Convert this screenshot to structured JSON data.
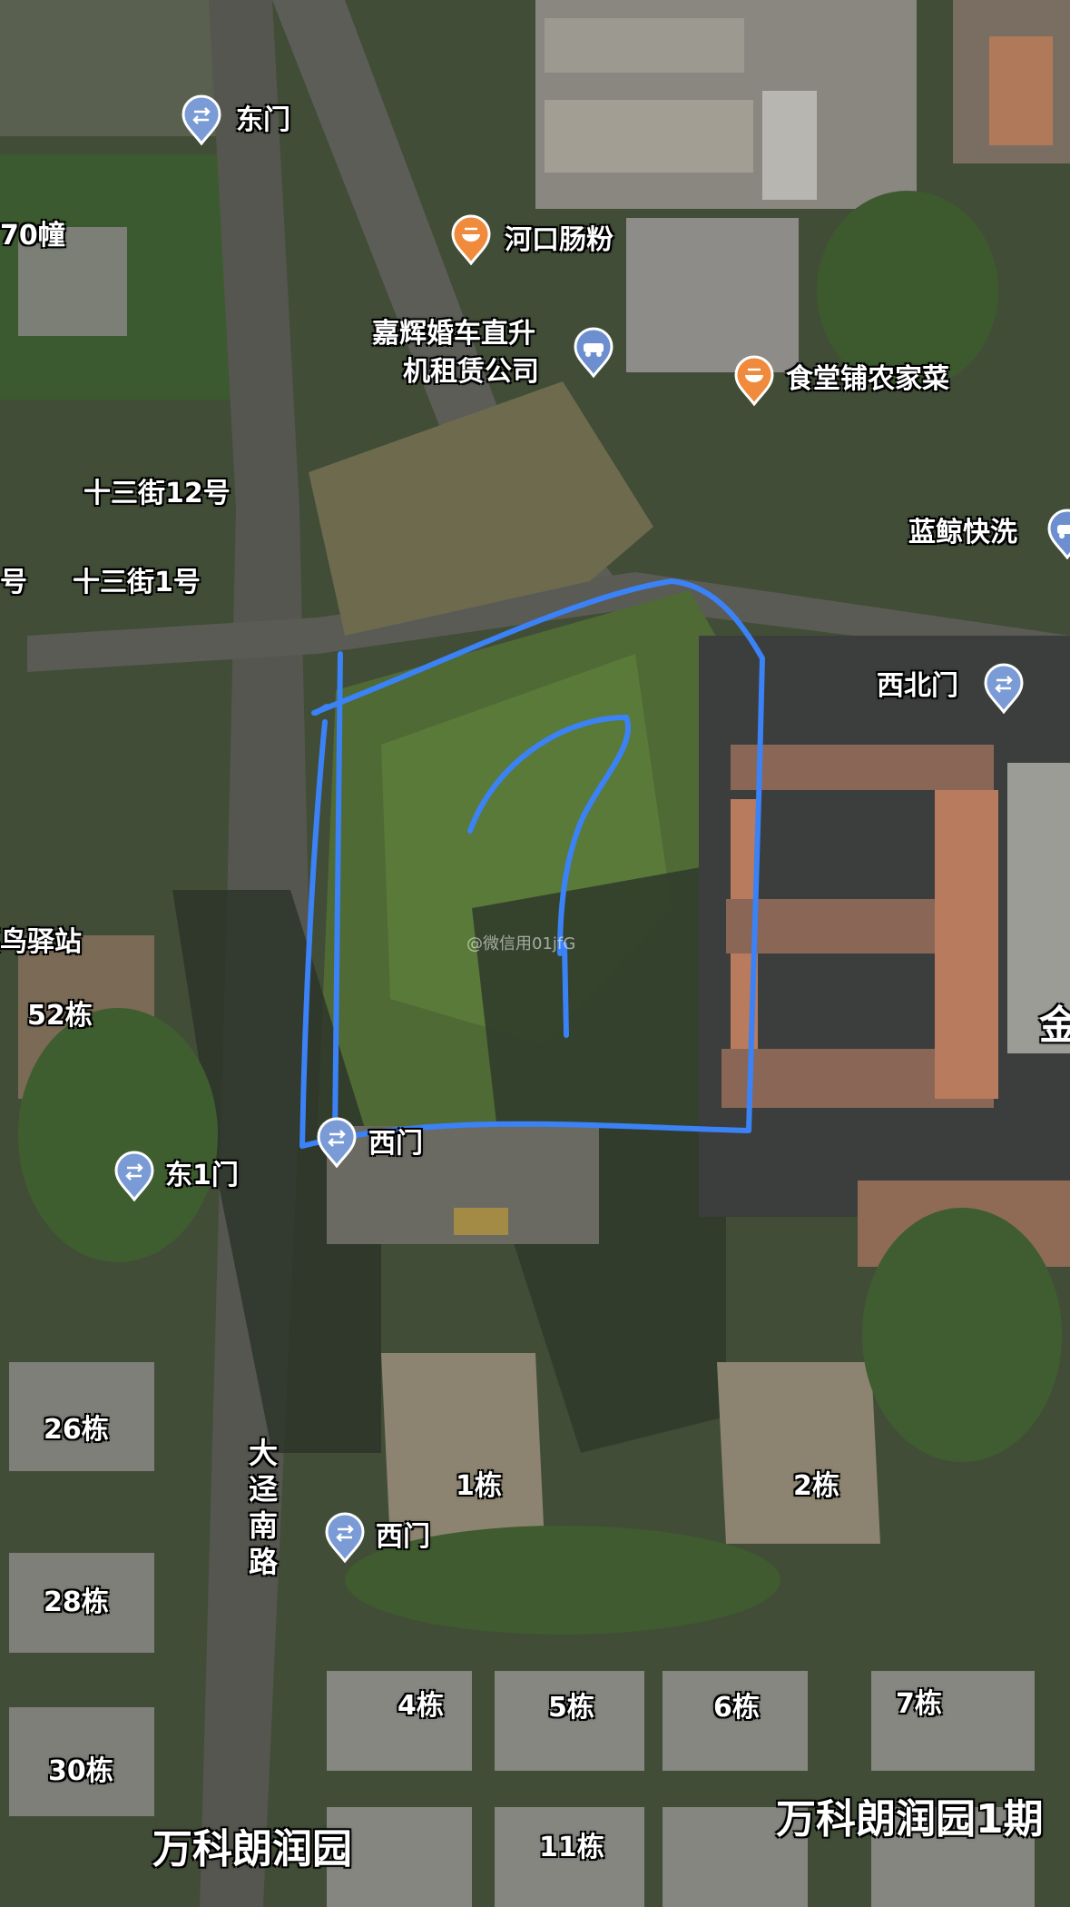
{
  "map": {
    "labels": {
      "dongmen_top": "东门",
      "lot70": "70幢",
      "hekou": "河口肠粉",
      "jiahui": "嘉辉婚车直升",
      "jiahui2": "机租赁公司",
      "shitang": "食堂铺农家菜",
      "jie12": "十三街12号",
      "hao_left": "号",
      "jie1": "十三街1号",
      "lanjing": "蓝鲸快洗",
      "xibeimen": "西北门",
      "cainiao": "菜鸟驿站",
      "b52": "52栋",
      "jin": "金",
      "ximen_mid": "西门",
      "dong1men": "东1门",
      "b26": "26栋",
      "b1": "1栋",
      "b2": "2栋",
      "road": "大迳南路",
      "ximen_low": "西门",
      "b28": "28栋",
      "b4": "4栋",
      "b5": "5栋",
      "b6": "6栋",
      "b7": "7栋",
      "b30": "30栋",
      "vanke_left": "万科朗润园",
      "b11": "11栋",
      "vanke_right": "万科朗润园1期"
    },
    "watermark": "@微信用01jfG",
    "annotation": "?",
    "colors": {
      "annotation": "#3b82f6",
      "gate_pin": "#7a9bd6",
      "food_pin": "#f08a3c",
      "car_pin": "#6d8fd0"
    }
  }
}
